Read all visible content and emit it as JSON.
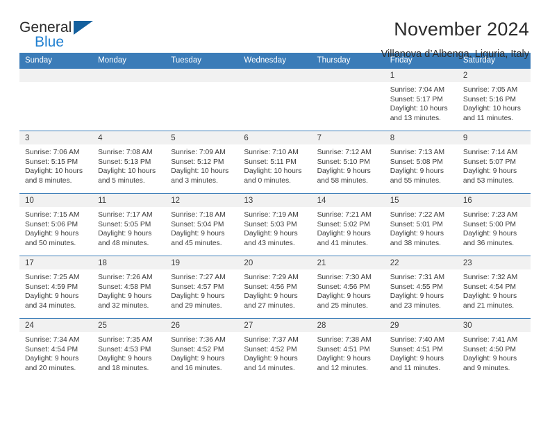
{
  "brand": {
    "name_top": "General",
    "name_bottom": "Blue",
    "color_dark": "#2b2b2b",
    "color_blue": "#1f7fd0",
    "triangle_color": "#14609e"
  },
  "header": {
    "title": "November 2024",
    "location": "Villanova d’Albenga, Liguria, Italy"
  },
  "theme": {
    "header_blue": "#3b7cb8",
    "daynum_band": "#f1f1f1",
    "text": "#3a3a3a"
  },
  "weekdays": [
    "Sunday",
    "Monday",
    "Tuesday",
    "Wednesday",
    "Thursday",
    "Friday",
    "Saturday"
  ],
  "weeks": [
    [
      {
        "day": "",
        "sunrise": "",
        "sunset": "",
        "daylight_1": "",
        "daylight_2": ""
      },
      {
        "day": "",
        "sunrise": "",
        "sunset": "",
        "daylight_1": "",
        "daylight_2": ""
      },
      {
        "day": "",
        "sunrise": "",
        "sunset": "",
        "daylight_1": "",
        "daylight_2": ""
      },
      {
        "day": "",
        "sunrise": "",
        "sunset": "",
        "daylight_1": "",
        "daylight_2": ""
      },
      {
        "day": "",
        "sunrise": "",
        "sunset": "",
        "daylight_1": "",
        "daylight_2": ""
      },
      {
        "day": "1",
        "sunrise": "Sunrise: 7:04 AM",
        "sunset": "Sunset: 5:17 PM",
        "daylight_1": "Daylight: 10 hours",
        "daylight_2": "and 13 minutes."
      },
      {
        "day": "2",
        "sunrise": "Sunrise: 7:05 AM",
        "sunset": "Sunset: 5:16 PM",
        "daylight_1": "Daylight: 10 hours",
        "daylight_2": "and 11 minutes."
      }
    ],
    [
      {
        "day": "3",
        "sunrise": "Sunrise: 7:06 AM",
        "sunset": "Sunset: 5:15 PM",
        "daylight_1": "Daylight: 10 hours",
        "daylight_2": "and 8 minutes."
      },
      {
        "day": "4",
        "sunrise": "Sunrise: 7:08 AM",
        "sunset": "Sunset: 5:13 PM",
        "daylight_1": "Daylight: 10 hours",
        "daylight_2": "and 5 minutes."
      },
      {
        "day": "5",
        "sunrise": "Sunrise: 7:09 AM",
        "sunset": "Sunset: 5:12 PM",
        "daylight_1": "Daylight: 10 hours",
        "daylight_2": "and 3 minutes."
      },
      {
        "day": "6",
        "sunrise": "Sunrise: 7:10 AM",
        "sunset": "Sunset: 5:11 PM",
        "daylight_1": "Daylight: 10 hours",
        "daylight_2": "and 0 minutes."
      },
      {
        "day": "7",
        "sunrise": "Sunrise: 7:12 AM",
        "sunset": "Sunset: 5:10 PM",
        "daylight_1": "Daylight: 9 hours",
        "daylight_2": "and 58 minutes."
      },
      {
        "day": "8",
        "sunrise": "Sunrise: 7:13 AM",
        "sunset": "Sunset: 5:08 PM",
        "daylight_1": "Daylight: 9 hours",
        "daylight_2": "and 55 minutes."
      },
      {
        "day": "9",
        "sunrise": "Sunrise: 7:14 AM",
        "sunset": "Sunset: 5:07 PM",
        "daylight_1": "Daylight: 9 hours",
        "daylight_2": "and 53 minutes."
      }
    ],
    [
      {
        "day": "10",
        "sunrise": "Sunrise: 7:15 AM",
        "sunset": "Sunset: 5:06 PM",
        "daylight_1": "Daylight: 9 hours",
        "daylight_2": "and 50 minutes."
      },
      {
        "day": "11",
        "sunrise": "Sunrise: 7:17 AM",
        "sunset": "Sunset: 5:05 PM",
        "daylight_1": "Daylight: 9 hours",
        "daylight_2": "and 48 minutes."
      },
      {
        "day": "12",
        "sunrise": "Sunrise: 7:18 AM",
        "sunset": "Sunset: 5:04 PM",
        "daylight_1": "Daylight: 9 hours",
        "daylight_2": "and 45 minutes."
      },
      {
        "day": "13",
        "sunrise": "Sunrise: 7:19 AM",
        "sunset": "Sunset: 5:03 PM",
        "daylight_1": "Daylight: 9 hours",
        "daylight_2": "and 43 minutes."
      },
      {
        "day": "14",
        "sunrise": "Sunrise: 7:21 AM",
        "sunset": "Sunset: 5:02 PM",
        "daylight_1": "Daylight: 9 hours",
        "daylight_2": "and 41 minutes."
      },
      {
        "day": "15",
        "sunrise": "Sunrise: 7:22 AM",
        "sunset": "Sunset: 5:01 PM",
        "daylight_1": "Daylight: 9 hours",
        "daylight_2": "and 38 minutes."
      },
      {
        "day": "16",
        "sunrise": "Sunrise: 7:23 AM",
        "sunset": "Sunset: 5:00 PM",
        "daylight_1": "Daylight: 9 hours",
        "daylight_2": "and 36 minutes."
      }
    ],
    [
      {
        "day": "17",
        "sunrise": "Sunrise: 7:25 AM",
        "sunset": "Sunset: 4:59 PM",
        "daylight_1": "Daylight: 9 hours",
        "daylight_2": "and 34 minutes."
      },
      {
        "day": "18",
        "sunrise": "Sunrise: 7:26 AM",
        "sunset": "Sunset: 4:58 PM",
        "daylight_1": "Daylight: 9 hours",
        "daylight_2": "and 32 minutes."
      },
      {
        "day": "19",
        "sunrise": "Sunrise: 7:27 AM",
        "sunset": "Sunset: 4:57 PM",
        "daylight_1": "Daylight: 9 hours",
        "daylight_2": "and 29 minutes."
      },
      {
        "day": "20",
        "sunrise": "Sunrise: 7:29 AM",
        "sunset": "Sunset: 4:56 PM",
        "daylight_1": "Daylight: 9 hours",
        "daylight_2": "and 27 minutes."
      },
      {
        "day": "21",
        "sunrise": "Sunrise: 7:30 AM",
        "sunset": "Sunset: 4:56 PM",
        "daylight_1": "Daylight: 9 hours",
        "daylight_2": "and 25 minutes."
      },
      {
        "day": "22",
        "sunrise": "Sunrise: 7:31 AM",
        "sunset": "Sunset: 4:55 PM",
        "daylight_1": "Daylight: 9 hours",
        "daylight_2": "and 23 minutes."
      },
      {
        "day": "23",
        "sunrise": "Sunrise: 7:32 AM",
        "sunset": "Sunset: 4:54 PM",
        "daylight_1": "Daylight: 9 hours",
        "daylight_2": "and 21 minutes."
      }
    ],
    [
      {
        "day": "24",
        "sunrise": "Sunrise: 7:34 AM",
        "sunset": "Sunset: 4:54 PM",
        "daylight_1": "Daylight: 9 hours",
        "daylight_2": "and 20 minutes."
      },
      {
        "day": "25",
        "sunrise": "Sunrise: 7:35 AM",
        "sunset": "Sunset: 4:53 PM",
        "daylight_1": "Daylight: 9 hours",
        "daylight_2": "and 18 minutes."
      },
      {
        "day": "26",
        "sunrise": "Sunrise: 7:36 AM",
        "sunset": "Sunset: 4:52 PM",
        "daylight_1": "Daylight: 9 hours",
        "daylight_2": "and 16 minutes."
      },
      {
        "day": "27",
        "sunrise": "Sunrise: 7:37 AM",
        "sunset": "Sunset: 4:52 PM",
        "daylight_1": "Daylight: 9 hours",
        "daylight_2": "and 14 minutes."
      },
      {
        "day": "28",
        "sunrise": "Sunrise: 7:38 AM",
        "sunset": "Sunset: 4:51 PM",
        "daylight_1": "Daylight: 9 hours",
        "daylight_2": "and 12 minutes."
      },
      {
        "day": "29",
        "sunrise": "Sunrise: 7:40 AM",
        "sunset": "Sunset: 4:51 PM",
        "daylight_1": "Daylight: 9 hours",
        "daylight_2": "and 11 minutes."
      },
      {
        "day": "30",
        "sunrise": "Sunrise: 7:41 AM",
        "sunset": "Sunset: 4:50 PM",
        "daylight_1": "Daylight: 9 hours",
        "daylight_2": "and 9 minutes."
      }
    ]
  ]
}
